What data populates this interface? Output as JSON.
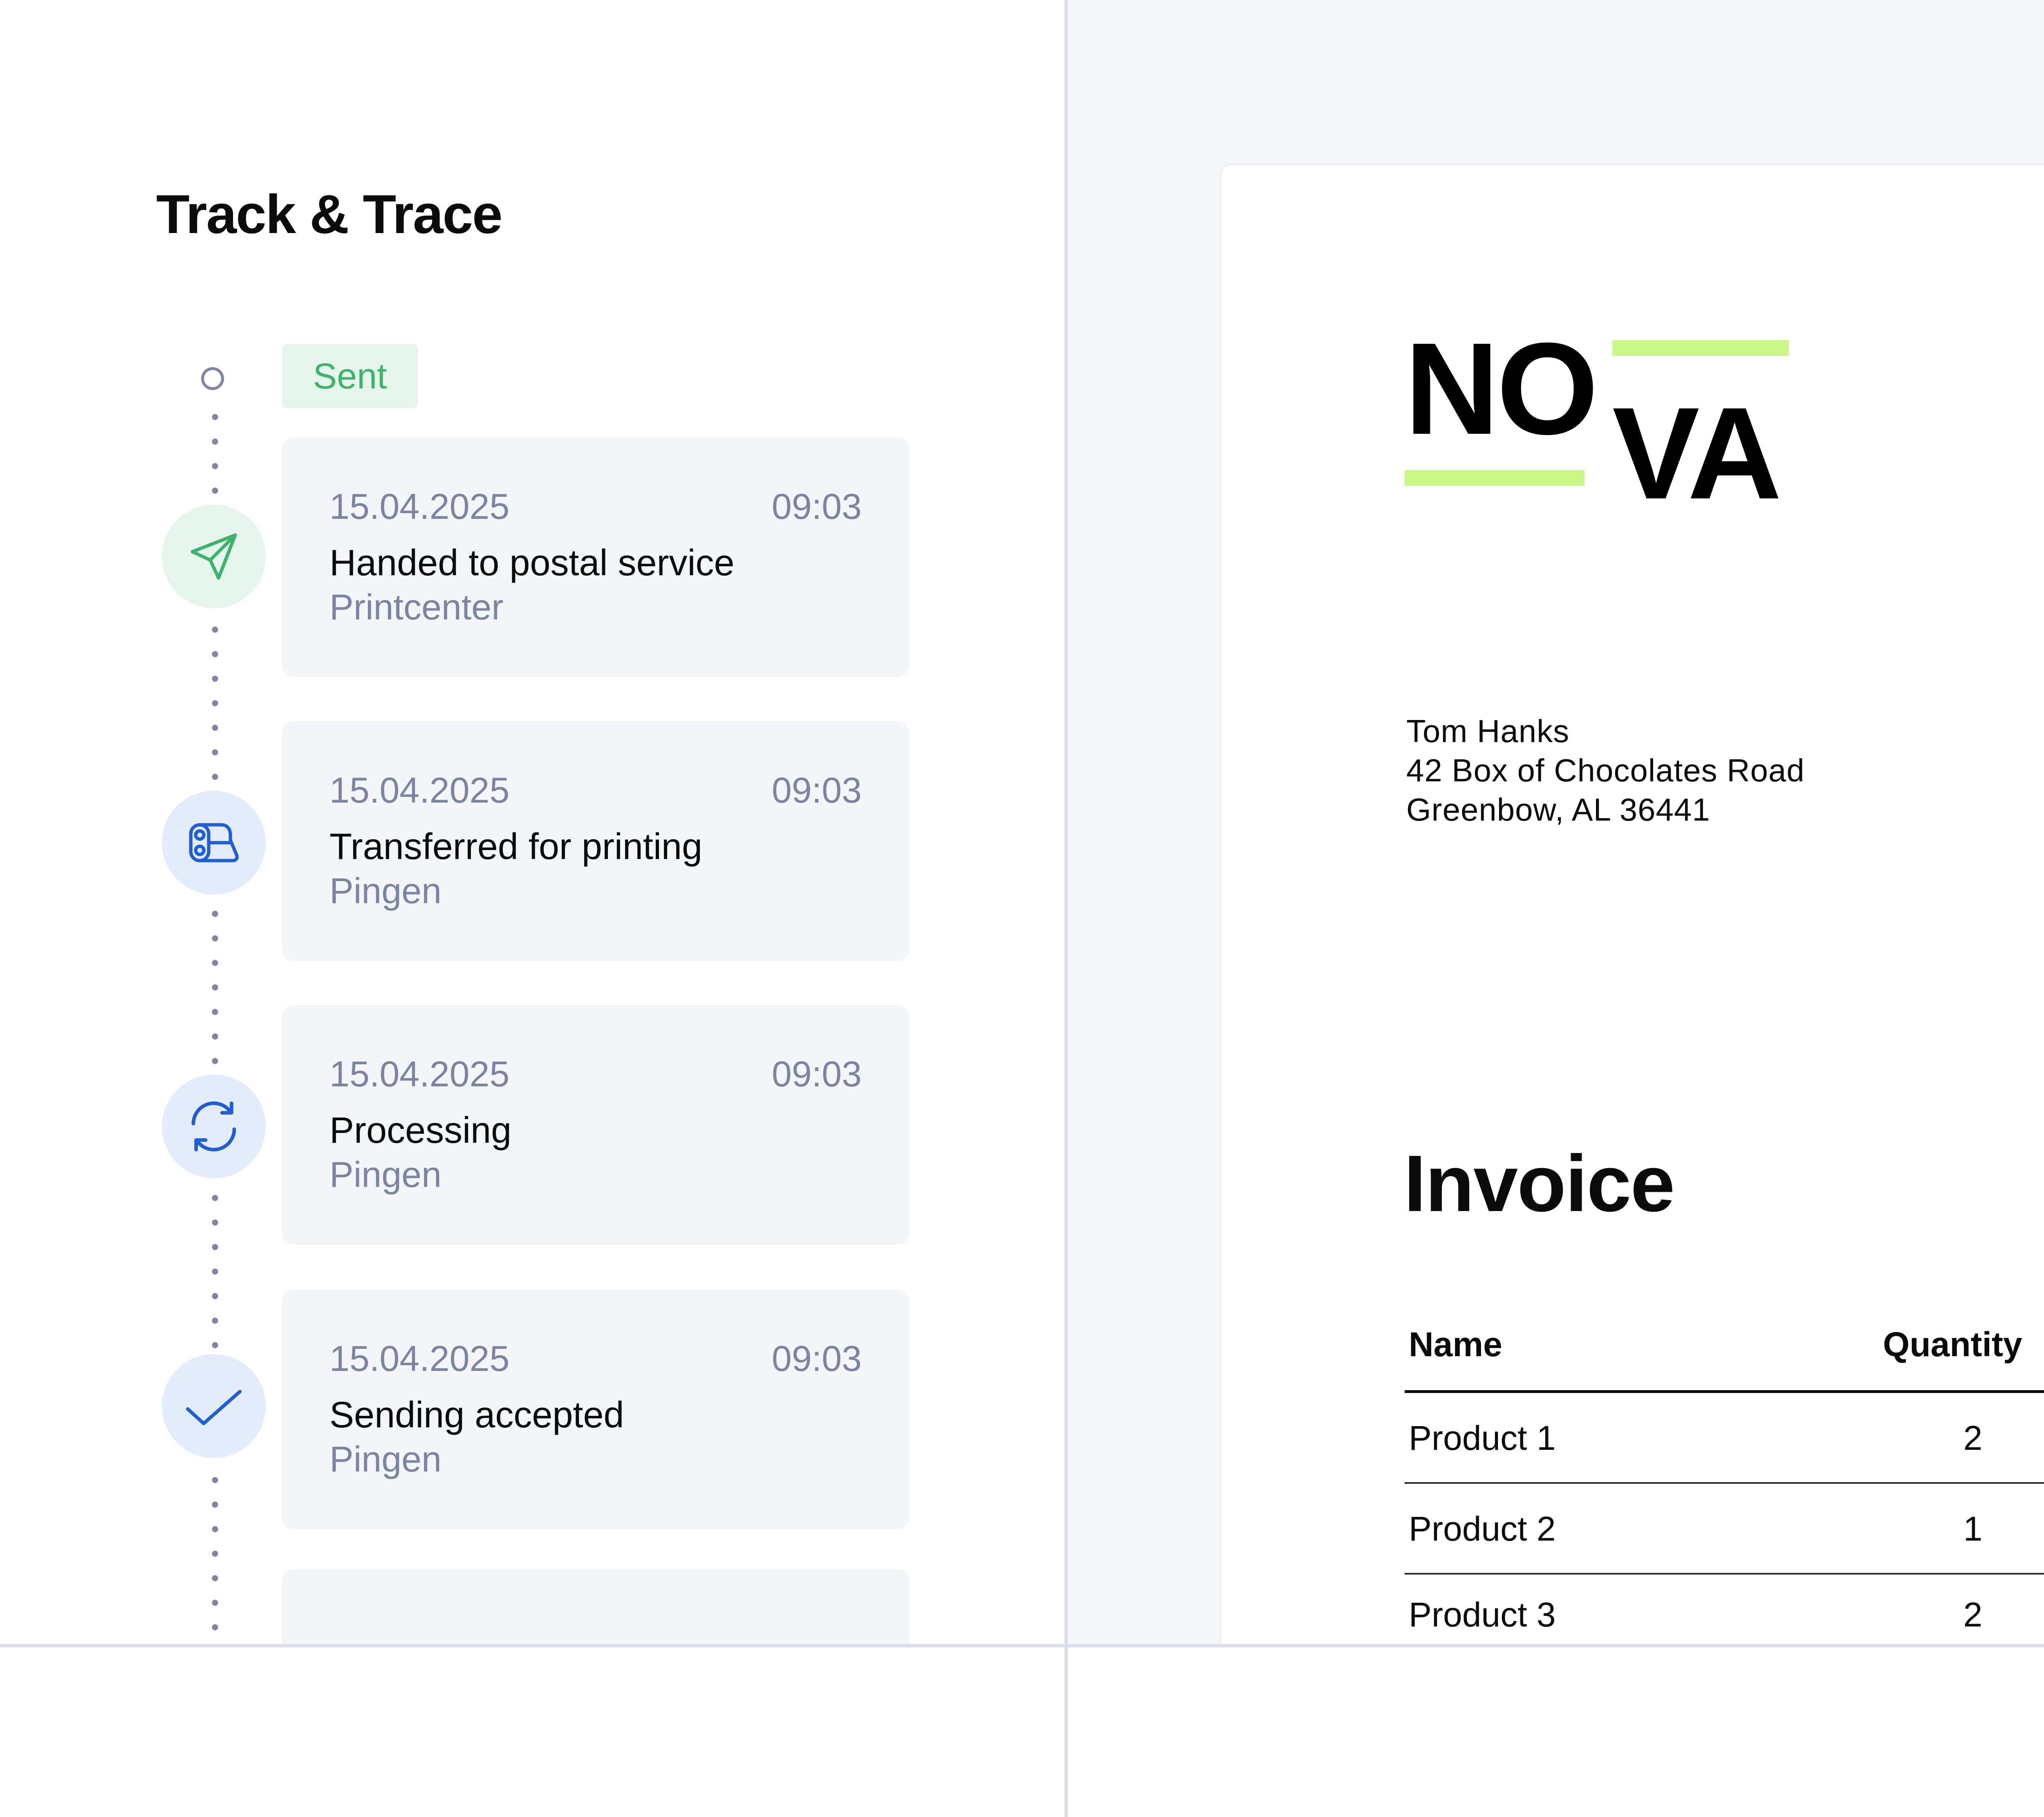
{
  "track": {
    "title": "Track & Trace",
    "status_badge": "Sent",
    "events": [
      {
        "date": "15.04.2025",
        "time": "09:03",
        "event": "Handed to postal service",
        "source": "Printcenter",
        "icon": "send-icon",
        "icon_color": "#3db36b"
      },
      {
        "date": "15.04.2025",
        "time": "09:03",
        "event": "Transferred for printing",
        "source": "Pingen",
        "icon": "printer-paper-icon",
        "icon_color": "#1f5fd6"
      },
      {
        "date": "15.04.2025",
        "time": "09:03",
        "event": "Processing",
        "source": "Pingen",
        "icon": "refresh-icon",
        "icon_color": "#1f5fd6"
      },
      {
        "date": "15.04.2025",
        "time": "09:03",
        "event": "Sending accepted",
        "source": "Pingen",
        "icon": "check-icon",
        "icon_color": "#1f5fd6"
      }
    ]
  },
  "invoice": {
    "logo_line1": "NO",
    "logo_line2": "VA",
    "logo_accent": "#c8f786",
    "recipient": {
      "name": "Tom Hanks",
      "street": "42 Box of Chocolates Road",
      "city": "Greenbow, AL 36441"
    },
    "title": "Invoice",
    "columns": {
      "name": "Name",
      "quantity": "Quantity"
    },
    "rows": [
      {
        "name": "Product 1",
        "quantity": "2"
      },
      {
        "name": "Product 2",
        "quantity": "1"
      },
      {
        "name": "Product 3",
        "quantity": "2"
      }
    ]
  }
}
